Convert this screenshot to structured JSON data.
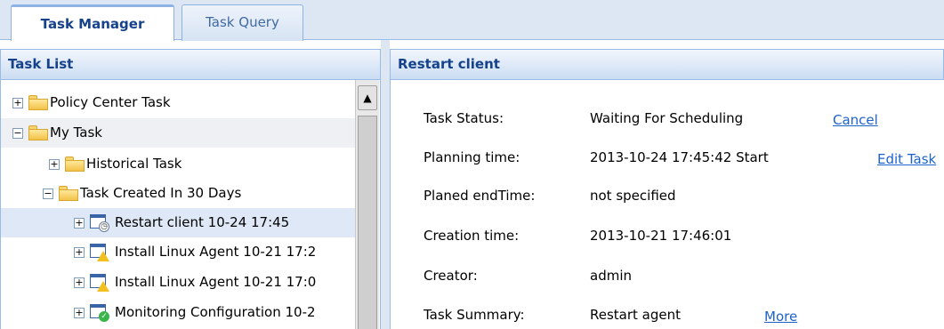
{
  "tabs": {
    "task_manager": "Task Manager",
    "task_query": "Task Query"
  },
  "task_list": {
    "title": "Task List",
    "items": [
      {
        "label": "Policy Center Task",
        "expander": "+"
      },
      {
        "label": "My Task",
        "expander": "−"
      },
      {
        "label": "Historical Task",
        "expander": "+"
      },
      {
        "label": "Task Created In 30 Days",
        "expander": "−"
      },
      {
        "label": "Restart client 10-24 17:45",
        "expander": "+",
        "status": "clock-icon"
      },
      {
        "label": "Install Linux Agent 10-21 17:2",
        "expander": "+",
        "status": "warning-icon"
      },
      {
        "label": "Install Linux Agent 10-21 17:0",
        "expander": "+",
        "status": "warning-icon"
      },
      {
        "label": "Monitoring Configuration 10-2",
        "expander": "+",
        "status": "success-icon"
      }
    ]
  },
  "detail": {
    "title": "Restart client",
    "fields": {
      "status": {
        "label": "Task Status:",
        "value": "Waiting For Scheduling",
        "link": "Cancel"
      },
      "planning": {
        "label": "Planning time:",
        "value": "2013-10-24 17:45:42 Start",
        "link": "Edit Task"
      },
      "end": {
        "label": "Planed endTime:",
        "value": "not specified"
      },
      "created": {
        "label": "Creation time:",
        "value": "2013-10-21 17:46:01"
      },
      "creator": {
        "label": "Creator:",
        "value": "admin"
      },
      "summary": {
        "label": "Task Summary:",
        "value": "Restart agent",
        "link": "More"
      }
    }
  },
  "colors": {
    "header_text": "#15428b",
    "link": "#1e63c9",
    "selection": "#dfe8f6"
  }
}
